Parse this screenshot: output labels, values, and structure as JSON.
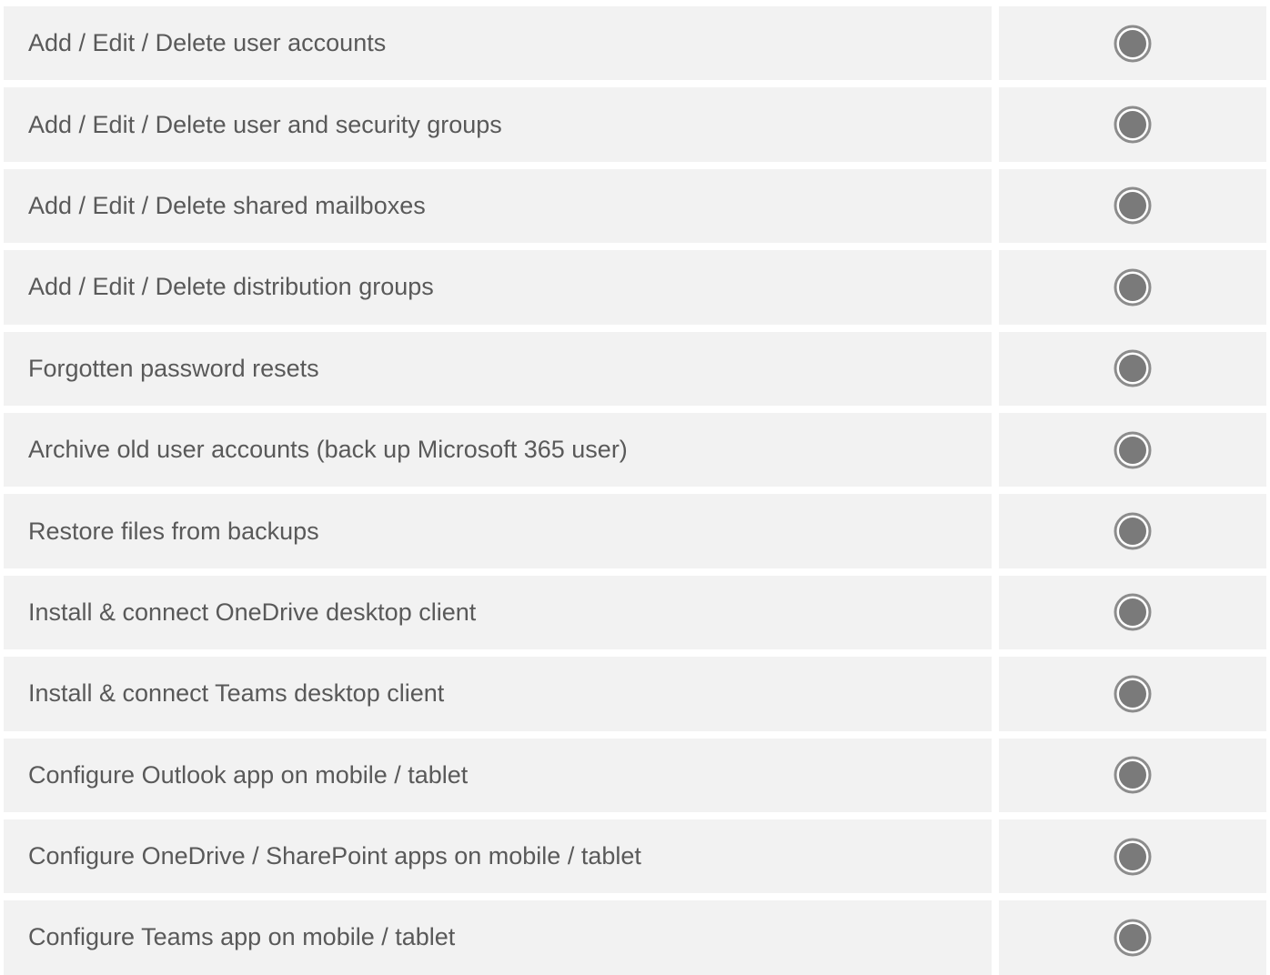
{
  "colors": {
    "row_background": "#f2f2f2",
    "text": "#595959",
    "icon_ring": "#8c8c8c",
    "icon_fill": "#7a7a7a"
  },
  "rows": [
    {
      "label": "Add / Edit / Delete user accounts",
      "icon": "filled-circle-icon"
    },
    {
      "label": "Add / Edit / Delete user and security groups",
      "icon": "filled-circle-icon"
    },
    {
      "label": "Add / Edit / Delete shared mailboxes",
      "icon": "filled-circle-icon"
    },
    {
      "label": "Add / Edit / Delete distribution groups",
      "icon": "filled-circle-icon"
    },
    {
      "label": "Forgotten password resets",
      "icon": "filled-circle-icon"
    },
    {
      "label": "Archive old user accounts (back up Microsoft 365 user)",
      "icon": "filled-circle-icon"
    },
    {
      "label": "Restore files from backups",
      "icon": "filled-circle-icon"
    },
    {
      "label": "Install & connect OneDrive desktop client",
      "icon": "filled-circle-icon"
    },
    {
      "label": "Install & connect Teams desktop client",
      "icon": "filled-circle-icon"
    },
    {
      "label": "Configure Outlook app on mobile / tablet",
      "icon": "filled-circle-icon"
    },
    {
      "label": "Configure OneDrive / SharePoint apps on mobile / tablet",
      "icon": "filled-circle-icon"
    },
    {
      "label": "Configure Teams app on mobile / tablet",
      "icon": "filled-circle-icon"
    }
  ]
}
